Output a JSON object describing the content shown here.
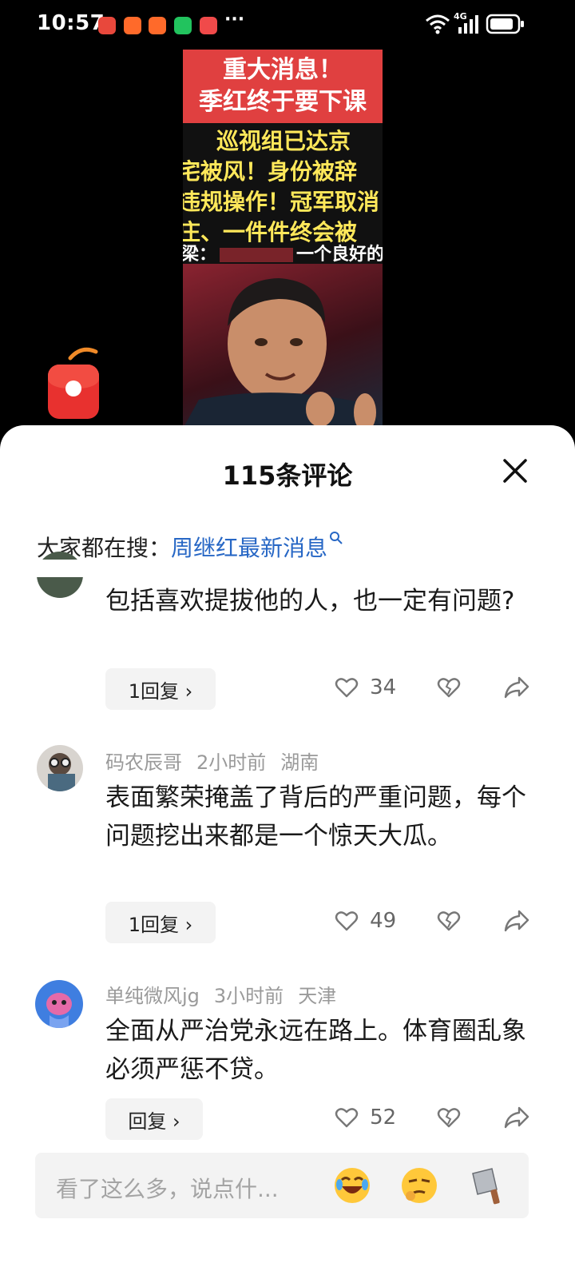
{
  "status_bar": {
    "time": "10:57",
    "more": "···",
    "network": "4G"
  },
  "video": {
    "banner_line1": "重大消息！",
    "banner_line2": "季红终于要下课",
    "yellow_lines": [
      "巡视组已达京",
      "宅被风！身份被辞",
      "违规操作！冠军取消",
      "庄、一件件终会被"
    ],
    "caption_prefix": "梁：",
    "caption_suffix": "一个良好的"
  },
  "sheet": {
    "title": "115条评论",
    "search_prefix": "大家都在搜：",
    "search_link": "周继红最新消息"
  },
  "comments": [
    {
      "username": "",
      "time": "",
      "location": "",
      "text": "包括喜欢提拔他的人，也一定有问题?",
      "reply_label": "1回复 ›",
      "likes": "34"
    },
    {
      "username": "码农辰哥",
      "time": "2小时前",
      "location": "湖南",
      "text": "表面繁荣掩盖了背后的严重问题，每个问题挖出来都是一个惊天大瓜。",
      "reply_label": "1回复 ›",
      "likes": "49"
    },
    {
      "username": "单纯微风jg",
      "time": "3小时前",
      "location": "天津",
      "text": "全面从严治党永远在路上。体育圈乱象必须严惩不贷。",
      "reply_label": "回复 ›",
      "likes": "52"
    }
  ],
  "input": {
    "placeholder": "看了这么多，说点什..."
  },
  "colors": {
    "link": "#2767c5",
    "banner": "#e04040",
    "caption_yellow": "#ffe85a",
    "packet": "#e8312f"
  },
  "icons": [
    "heart-icon",
    "broken-heart-icon",
    "share-icon",
    "close-icon",
    "search-icon",
    "laughing-emoji-icon",
    "thinking-emoji-icon",
    "cleaver-icon"
  ]
}
